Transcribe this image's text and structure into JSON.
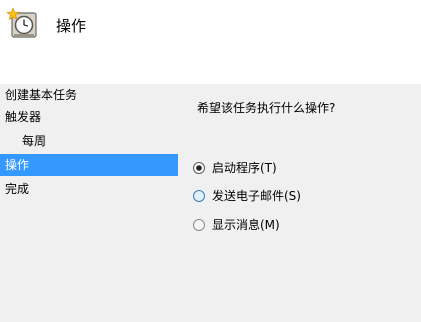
{
  "header": {
    "title": "操作",
    "icon": "scheduled-task-icon"
  },
  "sidebar": {
    "items": [
      {
        "label": "创建基本任务",
        "selected": false
      },
      {
        "label": "触发器",
        "selected": false
      },
      {
        "label": "每周",
        "selected": false
      },
      {
        "label": "操作",
        "selected": true
      },
      {
        "label": "完成",
        "selected": false
      }
    ]
  },
  "main": {
    "question": "希望该任务执行什么操作?",
    "options": [
      {
        "label": "启动程序(T)",
        "checked": true
      },
      {
        "label": "发送电子邮件(S)",
        "checked": false
      },
      {
        "label": "显示消息(M)",
        "checked": false
      }
    ]
  },
  "colors": {
    "selection": "#3399ff",
    "background": "#f0f0f0"
  }
}
